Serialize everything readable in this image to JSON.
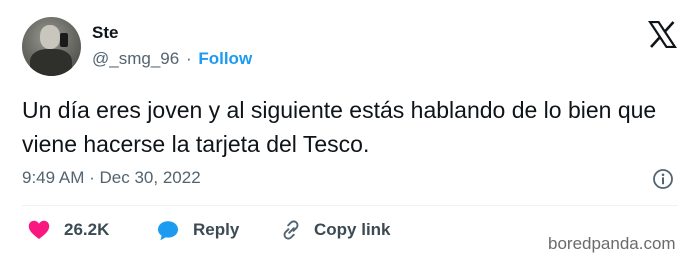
{
  "author": {
    "name": "Ste",
    "handle": "@_smg_96",
    "separator": "·",
    "follow_label": "Follow"
  },
  "tweet": {
    "text": "Un día eres joven y al siguiente estás hablando de lo bien que viene hacerse la tarjeta del Tesco.",
    "time": "9:49 AM",
    "date_separator": "·",
    "date": "Dec 30, 2022"
  },
  "actions": {
    "like_count": "26.2K",
    "reply_label": "Reply",
    "copy_label": "Copy link"
  },
  "watermark": "boredpanda.com",
  "icons": {
    "platform": "x-logo-icon",
    "info": "info-icon",
    "like": "heart-icon",
    "reply": "speech-bubble-icon",
    "copy": "link-icon"
  },
  "colors": {
    "heart": "#f91880",
    "reply_bubble": "#1d9bf0",
    "follow": "#1d9bf0",
    "secondary_text": "#536471"
  }
}
